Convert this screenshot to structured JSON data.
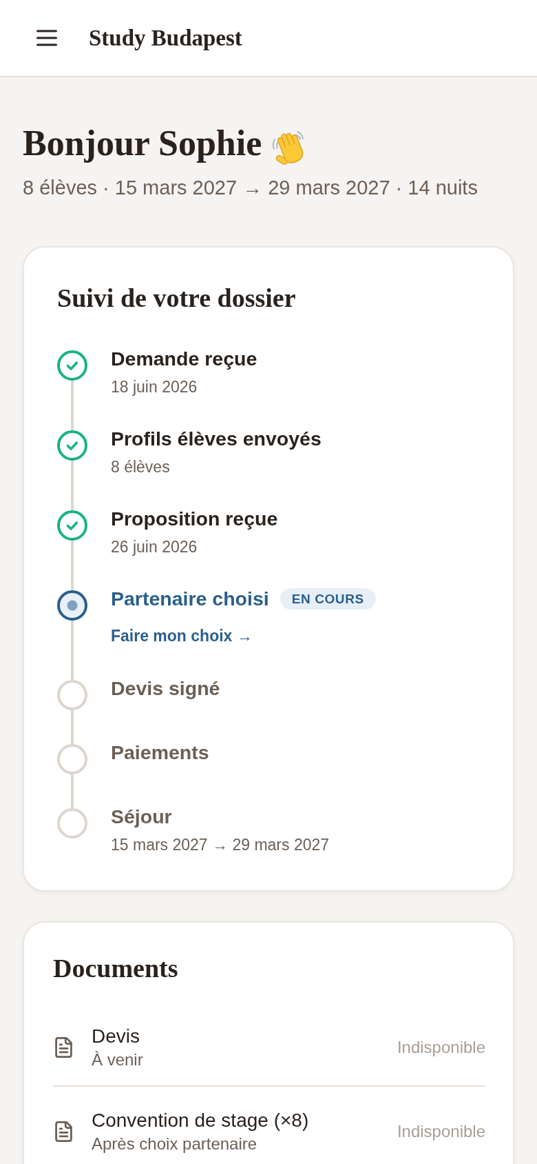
{
  "header": {
    "title": "Study Budapest"
  },
  "greeting": {
    "title": "Bonjour Sophie",
    "summary": "8 élèves · 15 mars 2027 → 29 mars 2027 · 14 nuits"
  },
  "tracking": {
    "title": "Suivi de votre dossier",
    "steps": [
      {
        "kind": "done",
        "label": "Demande reçue",
        "detail": "18 juin 2026"
      },
      {
        "kind": "done",
        "label": "Profils élèves envoyés",
        "detail": "8 élèves"
      },
      {
        "kind": "done",
        "label": "Proposition reçue",
        "detail": "26 juin 2026"
      },
      {
        "kind": "current",
        "label": "Partenaire choisi",
        "badge": "EN COURS",
        "link": "Faire mon choix →"
      },
      {
        "kind": "upcoming",
        "label": "Devis signé"
      },
      {
        "kind": "upcoming",
        "label": "Paiements"
      },
      {
        "kind": "upcoming",
        "label": "Séjour",
        "detail": "15 mars 2027 → 29 mars 2027"
      }
    ]
  },
  "documents": {
    "title": "Documents",
    "items": [
      {
        "name": "Devis",
        "note": "À venir",
        "status": "Indisponible",
        "disabled": true
      },
      {
        "name": "Convention de stage (×8)",
        "note": "Après choix partenaire",
        "status": "Indisponible",
        "disabled": true
      }
    ]
  }
}
